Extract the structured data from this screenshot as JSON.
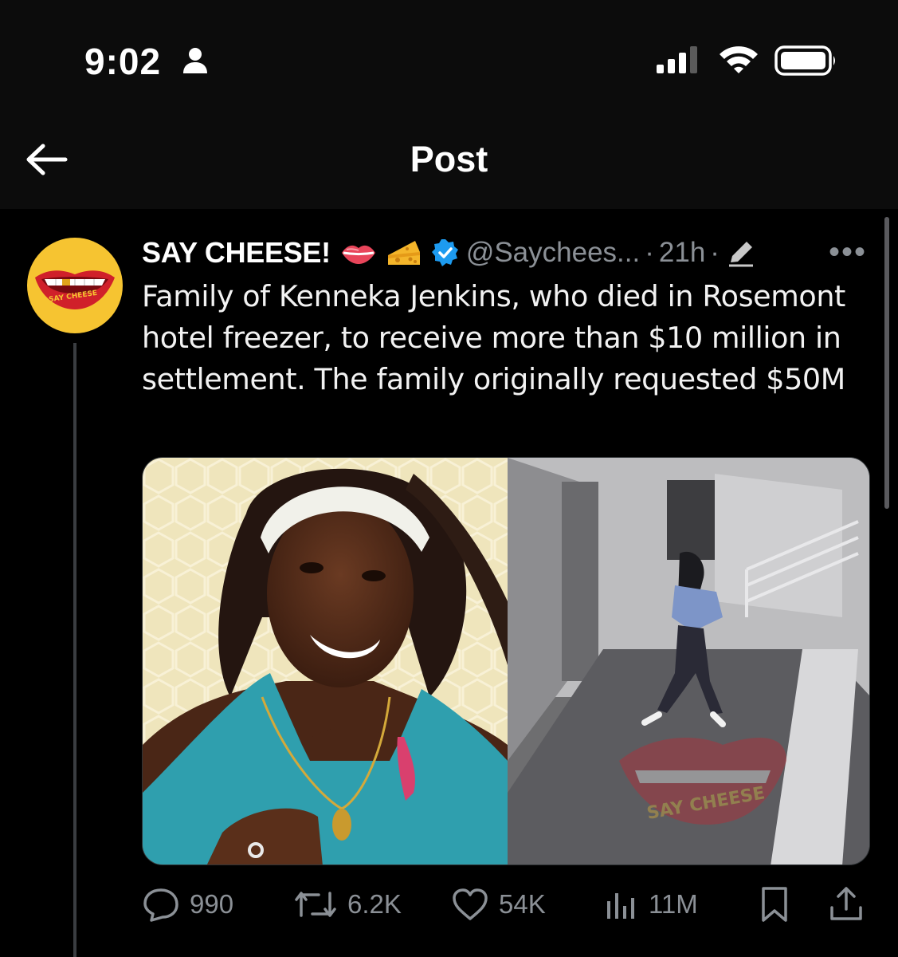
{
  "status_bar": {
    "time": "9:02",
    "person_icon": "person-icon",
    "signal_icon": "cellular-signal-icon",
    "wifi_icon": "wifi-icon",
    "battery_icon": "battery-icon"
  },
  "header": {
    "title": "Post",
    "back_icon": "back-arrow-icon"
  },
  "tweet": {
    "author_name": "SAY CHEESE!",
    "avatar_text": "SAY CHEESE",
    "badges": [
      "lips-emoji",
      "cheese-emoji",
      "verified-badge-icon"
    ],
    "handle": "@Saychees...",
    "separator": "·",
    "time": "21h",
    "edited_icon": "pencil-icon",
    "more_label": "•••",
    "text": "Family of Kenneka Jenkins, who died in Rosemont hotel freezer, to receive more than $10 million in settlement. The family originally requested $50M",
    "media": {
      "left_image": "portrait-photo",
      "right_image": "hallway-surveillance-photo",
      "watermark_text": "SAY CHEESE"
    },
    "actions": {
      "replies": "990",
      "reposts": "6.2K",
      "likes": "54K",
      "views": "11M"
    }
  },
  "colors": {
    "background": "#000000",
    "header_background": "#0c0c0c",
    "text": "#e7e9ea",
    "secondary": "#8b9096",
    "verified": "#1d9bf0",
    "avatar_bg": "#f6c431",
    "lips": "#d0202a"
  }
}
